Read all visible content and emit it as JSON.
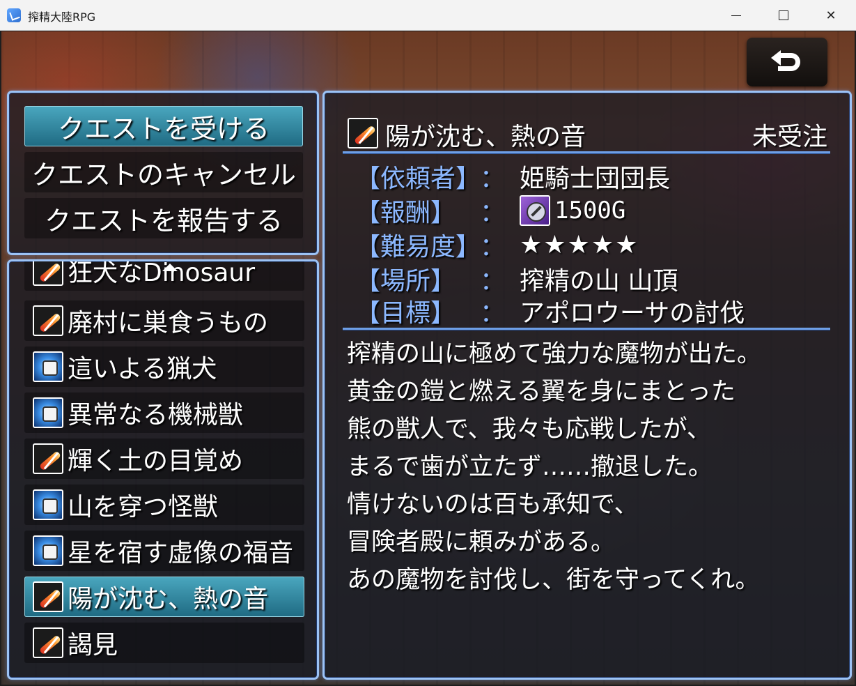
{
  "window": {
    "title": "搾精大陸RPG",
    "min_glyph": "",
    "close_glyph": "✕"
  },
  "commands": [
    {
      "label": "クエストを受ける",
      "selected": true
    },
    {
      "label": "クエストのキャンセル",
      "selected": false
    },
    {
      "label": "クエストを報告する",
      "selected": false
    }
  ],
  "quests": [
    {
      "label": "狂犬なDinosaur",
      "icon": "sword-icon"
    },
    {
      "label": "廃村に巣食うもの",
      "icon": "sword-icon"
    },
    {
      "label": "這いよる猟犬",
      "icon": "fist-icon"
    },
    {
      "label": "異常なる機械獣",
      "icon": "fist-icon"
    },
    {
      "label": "輝く土の目覚め",
      "icon": "sword-icon"
    },
    {
      "label": "山を穿つ怪獣",
      "icon": "fist-icon"
    },
    {
      "label": "星を宿す虚像の福音",
      "icon": "fist-icon"
    },
    {
      "label": "陽が沈む、熱の音",
      "icon": "sword-icon",
      "selected": true
    },
    {
      "label": "謁見",
      "icon": "sword-icon"
    }
  ],
  "detail": {
    "title": "陽が沈む、熱の音",
    "status": "未受注",
    "rows": {
      "client": {
        "key": "【依頼者】",
        "colon": "：",
        "value": "姫騎士団団長"
      },
      "reward": {
        "key": "【報酬】",
        "colon": "：",
        "value": "1500G"
      },
      "difficulty": {
        "key": "【難易度】",
        "colon": "：",
        "value": "★★★★★"
      },
      "location": {
        "key": "【場所】",
        "colon": "：",
        "value": "搾精の山 山頂"
      },
      "objective": {
        "key": "【目標】",
        "colon": "：",
        "value": "アポロウーサの討伐"
      }
    },
    "description": [
      "搾精の山に極めて強力な魔物が出た。",
      "黄金の鎧と燃える翼を身にまとった",
      "熊の獣人で、我々も応戦したが、",
      "まるで歯が立たず……撤退した。",
      "情けないのは百も承知で、",
      "冒険者殿に頼みがある。",
      "あの魔物を討伐し、街を守ってくれ。"
    ]
  },
  "colors": {
    "accent_border": "#9cc3f5",
    "selection": "#2f8aa3",
    "label_blue": "#8cb8ff"
  }
}
